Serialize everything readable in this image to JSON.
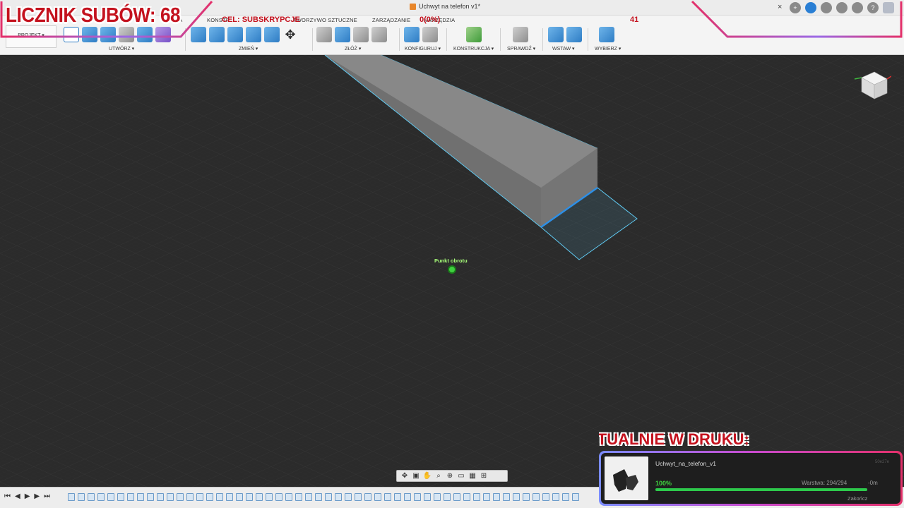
{
  "window": {
    "doc_title": "Uchwyt na telefon v1*",
    "close_glyph": "×"
  },
  "tabs": [
    "KONSTR...",
    "TWORZYWO SZTUCZNE",
    "ZARZĄDZANIE",
    "NARZĘDZIA"
  ],
  "tab_partial": "KA",
  "projekt_label": "PROJEKT ▾",
  "groups": {
    "utworz": "UTWÓRZ ▾",
    "zmien": "ZMIEŃ ▾",
    "zloz": "ZŁÓŻ ▾",
    "konfiguruj": "KONFIGURUJ ▾",
    "konstrukcja": "KONSTRUKCJA ▾",
    "sprawdz": "SPRAWDŹ ▾",
    "wstaw": "WSTAW ▾",
    "wybierz": "WYBIERZ ▾"
  },
  "viewport": {
    "pivot_label": "Punkt obrotu"
  },
  "overlay": {
    "sub_counter": "LICZNIK SUBÓW: 68",
    "goal_label": "CEL: SUBSKRYPCJE",
    "goal_value": "0(0%)",
    "goal_number": "41"
  },
  "print": {
    "title": "AKTUALNIE W DRUKU:",
    "file_name": "Uchwyt_na_telefon_v1",
    "id": "50e27e",
    "percent_label": "100%",
    "progress": 1.0,
    "layer": "Warstwa: 294/294",
    "eta": "-0m",
    "end_label": "Zakończ"
  },
  "colors": {
    "accent": "#c4121e",
    "selection": "#5fc8f0",
    "progress": "#2dc94b"
  }
}
